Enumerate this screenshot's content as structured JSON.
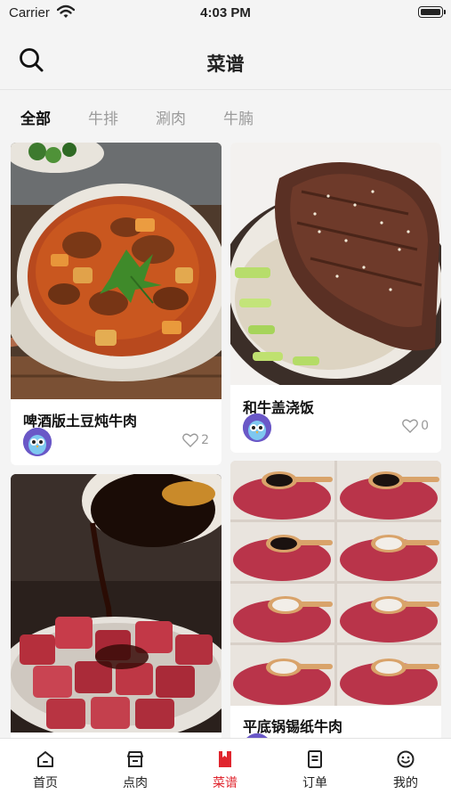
{
  "status_bar": {
    "carrier": "Carrier",
    "time": "4:03 PM"
  },
  "nav": {
    "title": "菜谱",
    "search_icon": "search-icon"
  },
  "tabs": [
    {
      "label": "全部",
      "active": true
    },
    {
      "label": "牛排",
      "active": false
    },
    {
      "label": "涮肉",
      "active": false
    },
    {
      "label": "牛腩",
      "active": false
    }
  ],
  "recipes": [
    {
      "title": "啤酒版土豆炖牛肉",
      "likes": "2",
      "image": "braised-beef-potato-stew"
    },
    {
      "title": "和牛盖浇饭",
      "likes": "0",
      "image": "wagyu-rice-bowl"
    },
    {
      "title": "",
      "likes": "",
      "image": "sauce-pouring-on-beef-cubes"
    },
    {
      "title": "平底锅锡纸牛肉",
      "likes": "",
      "image": "beef-marinade-steps-grid"
    }
  ],
  "tabbar": [
    {
      "label": "首页",
      "icon": "home-icon",
      "active": false
    },
    {
      "label": "点肉",
      "icon": "shop-icon",
      "active": false
    },
    {
      "label": "菜谱",
      "icon": "recipe-book-icon",
      "active": true
    },
    {
      "label": "订单",
      "icon": "order-icon",
      "active": false
    },
    {
      "label": "我的",
      "icon": "profile-icon",
      "active": false
    }
  ],
  "colors": {
    "accent": "#e0252e",
    "background": "#f4f4f4",
    "inactive_tab": "#9b9b9b"
  }
}
